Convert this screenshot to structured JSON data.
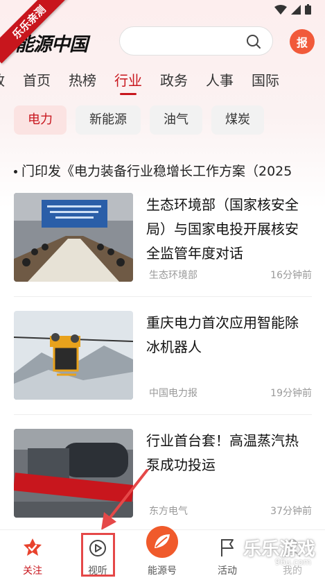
{
  "ribbon": {
    "text": "乐乐亲测"
  },
  "header": {
    "logo": "能源中国",
    "report_label": "报"
  },
  "tabs": [
    {
      "label": "政"
    },
    {
      "label": "首页"
    },
    {
      "label": "热榜"
    },
    {
      "label": "行业",
      "active": true
    },
    {
      "label": "政务"
    },
    {
      "label": "人事"
    },
    {
      "label": "国际"
    }
  ],
  "chips": [
    {
      "label": "电力",
      "active": true
    },
    {
      "label": "新能源"
    },
    {
      "label": "油气"
    },
    {
      "label": "煤炭"
    }
  ],
  "headline": "门印发《电力装备行业稳增长工作方案（2025",
  "news": [
    {
      "title": "生态环境部（国家核安全局）与国家电投开展核安全监管年度对话",
      "source": "生态环境部",
      "time": "16分钟前"
    },
    {
      "title": "重庆电力首次应用智能除冰机器人",
      "source": "中国电力报",
      "time": "19分钟前"
    },
    {
      "title": "行业首台套！高温蒸汽热泵成功投运",
      "source": "东方电气",
      "time": "37分钟前"
    }
  ],
  "bottom_nav": [
    {
      "label": "关注",
      "icon": "star-badge-icon",
      "active": true
    },
    {
      "label": "视听",
      "icon": "play-icon"
    },
    {
      "label": "能源号",
      "icon": "leaf-logo-icon"
    },
    {
      "label": "活动",
      "icon": "flag-icon"
    },
    {
      "label": "我的",
      "icon": "user-icon"
    }
  ],
  "watermark": {
    "title": "乐乐游戏",
    "url": "96u.com"
  },
  "colors": {
    "brand": "#c8161d",
    "chip_active_bg": "#fbe3e2"
  }
}
